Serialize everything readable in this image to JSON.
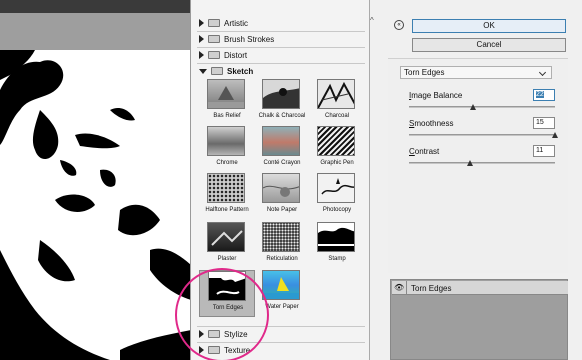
{
  "gallery": {
    "folders_top": [
      {
        "name": "Artistic"
      },
      {
        "name": "Brush Strokes"
      },
      {
        "name": "Distort"
      }
    ],
    "open_folder": "Sketch",
    "filters": [
      {
        "label": "Bas Relief"
      },
      {
        "label": "Chalk & Charcoal"
      },
      {
        "label": "Charcoal"
      },
      {
        "label": "Chrome"
      },
      {
        "label": "Conté Crayon"
      },
      {
        "label": "Graphic Pen"
      },
      {
        "label": "Halftone Pattern"
      },
      {
        "label": "Note Paper"
      },
      {
        "label": "Photocopy"
      },
      {
        "label": "Plaster"
      },
      {
        "label": "Reticulation"
      },
      {
        "label": "Stamp"
      },
      {
        "label": "Torn Edges"
      },
      {
        "label": "Water Paper"
      }
    ],
    "selected_filter": "Torn Edges",
    "folders_bottom": [
      {
        "name": "Stylize"
      },
      {
        "name": "Texture"
      }
    ]
  },
  "dialog": {
    "ok_label": "OK",
    "cancel_label": "Cancel",
    "filter_dropdown": "Torn Edges",
    "params": [
      {
        "label_pre": "",
        "label_u": "I",
        "label_post": "mage Balance",
        "value": "22",
        "level": 0.44
      },
      {
        "label_pre": "",
        "label_u": "S",
        "label_post": "moothness",
        "value": "15",
        "level": 1.0
      },
      {
        "label_pre": "",
        "label_u": "C",
        "label_post": "ontrast",
        "value": "11",
        "level": 0.42
      }
    ],
    "layer_name": "Torn Edges"
  },
  "colors": {
    "accent": "#3c7fb1",
    "highlight_ring": "#e0298a"
  }
}
